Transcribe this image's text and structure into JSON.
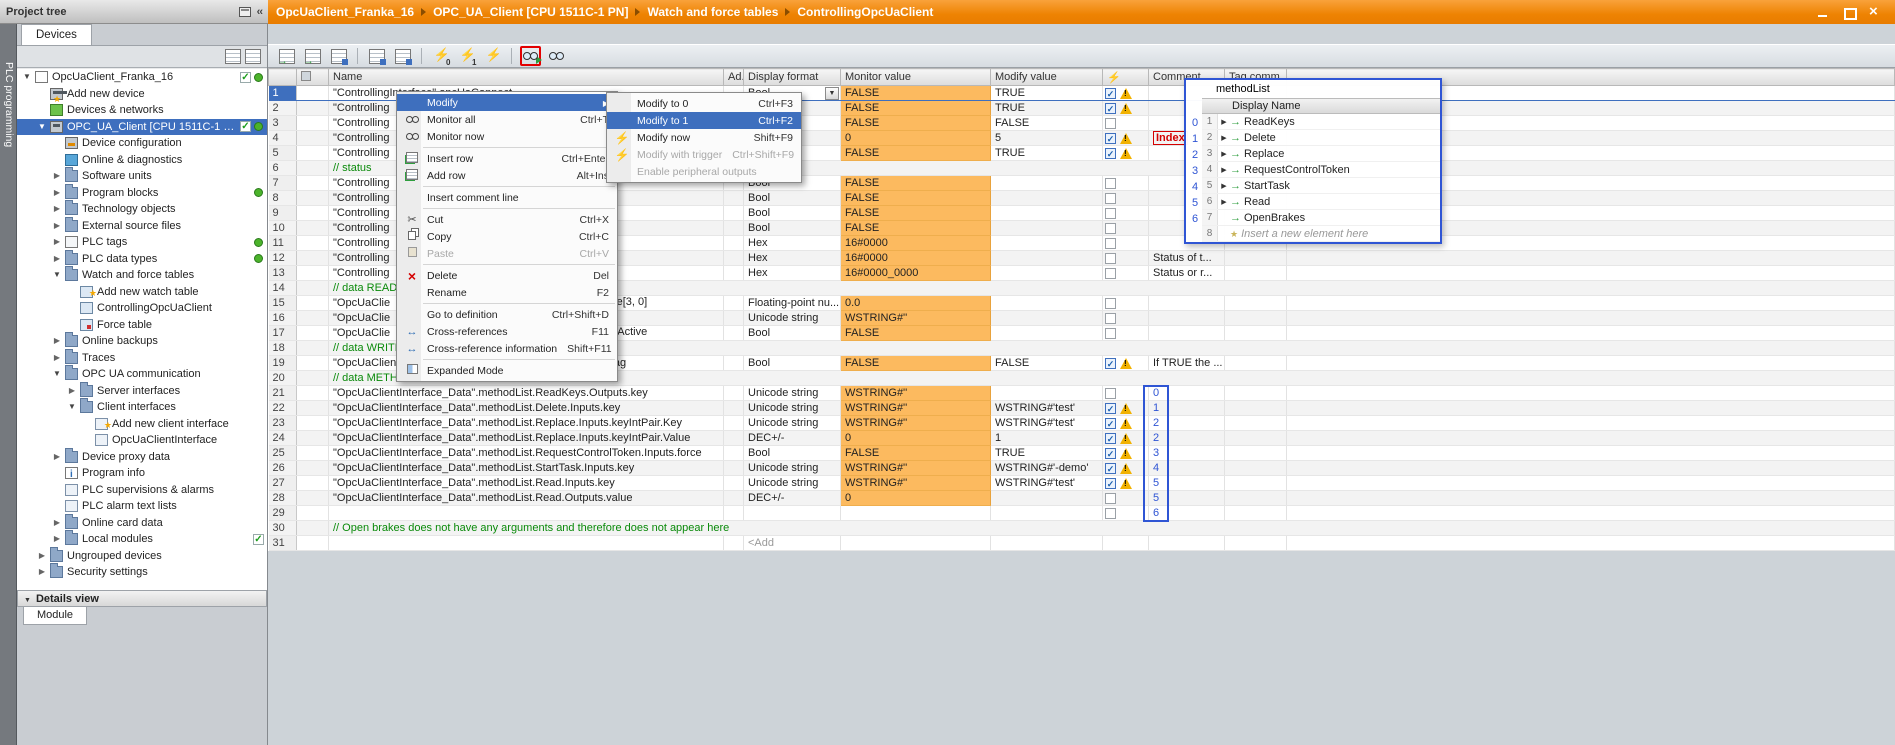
{
  "titlebar": {
    "project_tree": "Project tree",
    "breadcrumb": [
      "OpcUaClient_Franka_16",
      "OPC_UA_Client [CPU 1511C-1 PN]",
      "Watch and force tables",
      "ControllingOpcUaClient"
    ]
  },
  "sidebar": {
    "vertical_tab": "PLC programming",
    "devices_tab": "Devices",
    "details_view_label": "Details view",
    "module_tab_label": "Module",
    "tree": [
      {
        "label": "OpcUaClient_Franka_16",
        "level": 0,
        "arrow": "exp",
        "icon": "i-project",
        "status": [
          "check",
          "dot"
        ]
      },
      {
        "label": "Add new device",
        "level": 1,
        "icon": "i-plc",
        "star": true
      },
      {
        "label": "Devices & networks",
        "level": 1,
        "icon": "i-network"
      },
      {
        "label": "OPC_UA_Client [CPU 1511C-1 PN]",
        "level": 1,
        "arrow": "exp",
        "icon": "i-plc",
        "status": [
          "check",
          "dot"
        ],
        "selected": true
      },
      {
        "label": "Device configuration",
        "level": 2,
        "icon": "i-devconf"
      },
      {
        "label": "Online & diagnostics",
        "level": 2,
        "icon": "i-diag"
      },
      {
        "label": "Software units",
        "level": 2,
        "arrow": "col",
        "icon": "i-folder"
      },
      {
        "label": "Program blocks",
        "level": 2,
        "arrow": "col",
        "icon": "i-folder",
        "status": [
          "dot"
        ]
      },
      {
        "label": "Technology objects",
        "level": 2,
        "arrow": "col",
        "icon": "i-folder"
      },
      {
        "label": "External source files",
        "level": 2,
        "arrow": "col",
        "icon": "i-folder"
      },
      {
        "label": "PLC tags",
        "level": 2,
        "arrow": "col",
        "icon": "i-tags",
        "status": [
          "dot"
        ]
      },
      {
        "label": "PLC data types",
        "level": 2,
        "arrow": "col",
        "icon": "i-folder",
        "status": [
          "dot"
        ]
      },
      {
        "label": "Watch and force tables",
        "level": 2,
        "arrow": "exp",
        "icon": "i-folder"
      },
      {
        "label": "Add new watch table",
        "level": 3,
        "icon": "i-watch",
        "star": true
      },
      {
        "label": "ControllingOpcUaClient",
        "level": 3,
        "icon": "i-watch"
      },
      {
        "label": "Force table",
        "level": 3,
        "icon": "i-force"
      },
      {
        "label": "Online backups",
        "level": 2,
        "arrow": "col",
        "icon": "i-folder"
      },
      {
        "label": "Traces",
        "level": 2,
        "arrow": "col",
        "icon": "i-folder"
      },
      {
        "label": "OPC UA communication",
        "level": 2,
        "arrow": "exp",
        "icon": "i-folder"
      },
      {
        "label": "Server interfaces",
        "level": 3,
        "arrow": "col",
        "icon": "i-folder"
      },
      {
        "label": "Client interfaces",
        "level": 3,
        "arrow": "exp",
        "icon": "i-folder"
      },
      {
        "label": "Add new client interface",
        "level": 4,
        "icon": "i-iface",
        "star": true
      },
      {
        "label": "OpcUaClientInterface",
        "level": 4,
        "icon": "i-iface"
      },
      {
        "label": "Device proxy data",
        "level": 2,
        "arrow": "col",
        "icon": "i-folder"
      },
      {
        "label": "Program info",
        "level": 2,
        "icon": "i-info"
      },
      {
        "label": "PLC supervisions & alarms",
        "level": 2,
        "icon": "i-superv"
      },
      {
        "label": "PLC alarm text lists",
        "level": 2,
        "icon": "i-alarm"
      },
      {
        "label": "Online card data",
        "level": 2,
        "arrow": "col",
        "icon": "i-folder"
      },
      {
        "label": "Local modules",
        "level": 2,
        "arrow": "col",
        "icon": "i-folder",
        "status": [
          "check"
        ]
      },
      {
        "label": "Ungrouped devices",
        "level": 1,
        "arrow": "col",
        "icon": "i-folder"
      },
      {
        "label": "Security settings",
        "level": 1,
        "arrow": "col",
        "icon": "i-folder"
      }
    ]
  },
  "toolbar": {
    "icons": [
      {
        "name": "insert-row-icon",
        "cls": "grid g-green"
      },
      {
        "name": "add-row-icon",
        "cls": "grid g-green"
      },
      {
        "name": "insert-comment-icon",
        "cls": "grid g-blue"
      },
      {
        "sep": true
      },
      {
        "name": "show-all-format-icon",
        "cls": "grid g-blue"
      },
      {
        "name": "show-modify-column-icon",
        "cls": "grid g-blue"
      },
      {
        "sep": true
      },
      {
        "name": "modify-to-0-icon",
        "cls": "bolt",
        "sub": "0"
      },
      {
        "name": "modify-to-1-icon",
        "cls": "bolt",
        "sub": "1"
      },
      {
        "name": "modify-now-icon",
        "cls": "bolt"
      },
      {
        "sep": true
      },
      {
        "name": "monitor-all-icon",
        "cls": "glasses play",
        "redbox": true
      },
      {
        "name": "monitor-now-icon",
        "cls": "glasses"
      }
    ]
  },
  "table": {
    "headers": [
      "",
      "",
      "Name",
      "Ad...",
      "Display format",
      "Monitor value",
      "Modify value",
      "",
      "Comment",
      "Tag comm...",
      ""
    ],
    "rows": [
      {
        "n": 1,
        "name": "\"ControllingInterface\".opcUaConnect",
        "display": "Bool",
        "monitor": "FALSE",
        "morange": true,
        "modify": "TRUE",
        "check": "on",
        "warn": true,
        "sel": true,
        "combo": true
      },
      {
        "n": 2,
        "name": "\"Controlling",
        "display": "Bool",
        "monitor": "FALSE",
        "morange": true,
        "modify": "TRUE",
        "check": "on",
        "warn": true
      },
      {
        "n": 3,
        "name": "\"Controlling",
        "display": "Bool",
        "monitor": "FALSE",
        "morange": true,
        "modify": "FALSE",
        "check": "off"
      },
      {
        "n": 4,
        "name": "\"Controlling",
        "display": "DEC+/-",
        "monitor": "0",
        "morange": true,
        "modify": "5",
        "check": "on",
        "warn": true,
        "comment": "Index",
        "commentRed": true
      },
      {
        "n": 5,
        "name": "\"Controlling",
        "display": "Bool",
        "monitor": "FALSE",
        "morange": true,
        "modify": "TRUE",
        "check": "on",
        "warn": true
      },
      {
        "n": 6,
        "kind": "comment",
        "name": "// status"
      },
      {
        "n": 7,
        "name": "\"Controlling",
        "display": "Bool",
        "monitor": "FALSE",
        "morange": true,
        "check": "off"
      },
      {
        "n": 8,
        "name": "\"Controlling",
        "display": "Bool",
        "monitor": "FALSE",
        "morange": true,
        "check": "off"
      },
      {
        "n": 9,
        "name": "\"Controlling",
        "display": "Bool",
        "monitor": "FALSE",
        "morange": true,
        "check": "off"
      },
      {
        "n": 10,
        "name": "\"Controlling",
        "display": "Bool",
        "monitor": "FALSE",
        "morange": true,
        "check": "off"
      },
      {
        "n": 11,
        "name": "\"Controlling",
        "display": "Hex",
        "monitor": "16#0000",
        "morange": true,
        "check": "off"
      },
      {
        "n": 12,
        "name": "\"Controlling",
        "display": "Hex",
        "monitor": "16#0000",
        "morange": true,
        "check": "off",
        "comment": "Status of t..."
      },
      {
        "n": 13,
        "name": "\"Controlling",
        "tail": "s",
        "display": "Hex",
        "monitor": "16#0000_0000",
        "morange": true,
        "check": "off",
        "comment": "Status or r..."
      },
      {
        "n": 14,
        "kind": "comment",
        "name": "// data READ"
      },
      {
        "n": 15,
        "name": "\"OpcUaClie",
        "tail": "ose[3, 0]",
        "display": "Floating-point nu...",
        "monitor": "0.0",
        "morange": true,
        "check": "off"
      },
      {
        "n": 16,
        "name": "\"OpcUaClie",
        "display": "Unicode string",
        "monitor": "WSTRING#''",
        "morange": true,
        "check": "off"
      },
      {
        "n": 17,
        "name": "\"OpcUaClie",
        "tail": "enActive",
        "display": "Bool",
        "monitor": "FALSE",
        "morange": true,
        "check": "off"
      },
      {
        "n": 18,
        "kind": "comment",
        "name": "// data WRITE"
      },
      {
        "n": 19,
        "name": "\"OpcUaClientInterface_Data\".writeList.Variable.EnabledFlag",
        "display": "Bool",
        "monitor": "FALSE",
        "morange": true,
        "modify": "FALSE",
        "check": "on",
        "warn": true,
        "comment": "If TRUE the ..."
      },
      {
        "n": 20,
        "kind": "comment",
        "name": "// data METHOD"
      },
      {
        "n": 21,
        "name": "\"OpcUaClientInterface_Data\".methodList.ReadKeys.Outputs.key",
        "display": "Unicode string",
        "monitor": "WSTRING#''",
        "morange": true,
        "check": "off",
        "idx": "0"
      },
      {
        "n": 22,
        "name": "\"OpcUaClientInterface_Data\".methodList.Delete.Inputs.key",
        "display": "Unicode string",
        "monitor": "WSTRING#''",
        "morange": true,
        "modify": "WSTRING#'test'",
        "check": "on",
        "warn": true,
        "idx": "1"
      },
      {
        "n": 23,
        "name": "\"OpcUaClientInterface_Data\".methodList.Replace.Inputs.keyIntPair.Key",
        "display": "Unicode string",
        "monitor": "WSTRING#''",
        "morange": true,
        "modify": "WSTRING#'test'",
        "check": "on",
        "warn": true,
        "idx": "2"
      },
      {
        "n": 24,
        "name": "\"OpcUaClientInterface_Data\".methodList.Replace.Inputs.keyIntPair.Value",
        "display": "DEC+/-",
        "monitor": "0",
        "morange": true,
        "modify": "1",
        "check": "on",
        "warn": true,
        "idx": "2"
      },
      {
        "n": 25,
        "name": "\"OpcUaClientInterface_Data\".methodList.RequestControlToken.Inputs.force",
        "display": "Bool",
        "monitor": "FALSE",
        "morange": true,
        "modify": "TRUE",
        "check": "on",
        "warn": true,
        "idx": "3"
      },
      {
        "n": 26,
        "name": "\"OpcUaClientInterface_Data\".methodList.StartTask.Inputs.key",
        "display": "Unicode string",
        "monitor": "WSTRING#''",
        "morange": true,
        "modify": "WSTRING#'-demo'",
        "check": "on",
        "warn": true,
        "idx": "4"
      },
      {
        "n": 27,
        "name": "\"OpcUaClientInterface_Data\".methodList.Read.Inputs.key",
        "display": "Unicode string",
        "monitor": "WSTRING#''",
        "morange": true,
        "modify": "WSTRING#'test'",
        "check": "on",
        "warn": true,
        "idx": "5"
      },
      {
        "n": 28,
        "name": "\"OpcUaClientInterface_Data\".methodList.Read.Outputs.value",
        "display": "DEC+/-",
        "monitor": "0",
        "morange": true,
        "check": "off",
        "idx": "5"
      },
      {
        "n": 29,
        "check": "off",
        "idx": "6"
      },
      {
        "n": 30,
        "kind": "comment",
        "name": "// Open brakes does not have any arguments and therefore does not appear here"
      },
      {
        "n": 31,
        "display": "<Add",
        "displayGrey": true
      }
    ]
  },
  "context_menu": {
    "items": [
      {
        "label": "Modify",
        "icon": "",
        "submenu": true,
        "highlighted": true
      },
      {
        "label": "Monitor all",
        "shortcut": "Ctrl+T",
        "icon": "glasses"
      },
      {
        "label": "Monitor now",
        "icon": "glasses"
      },
      {
        "separator": true
      },
      {
        "label": "Insert row",
        "shortcut": "Ctrl+Enter",
        "icon": "grid-green"
      },
      {
        "label": "Add row",
        "shortcut": "Alt+Ins",
        "icon": "grid-green"
      },
      {
        "separator": true
      },
      {
        "label": "Insert comment line",
        "icon": ""
      },
      {
        "separator": true
      },
      {
        "label": "Cut",
        "shortcut": "Ctrl+X",
        "icon": "cut"
      },
      {
        "label": "Copy",
        "shortcut": "Ctrl+C",
        "icon": "copy"
      },
      {
        "label": "Paste",
        "shortcut": "Ctrl+V",
        "icon": "paste",
        "disabled": true
      },
      {
        "separator": true
      },
      {
        "label": "Delete",
        "shortcut": "Del",
        "icon": "delete"
      },
      {
        "label": "Rename",
        "shortcut": "F2",
        "icon": ""
      },
      {
        "separator": true
      },
      {
        "label": "Go to definition",
        "shortcut": "Ctrl+Shift+D",
        "icon": ""
      },
      {
        "label": "Cross-references",
        "shortcut": "F11",
        "icon": "xref"
      },
      {
        "label": "Cross-reference information",
        "shortcut": "Shift+F11",
        "icon": "xref"
      },
      {
        "separator": true
      },
      {
        "label": "Expanded Mode",
        "icon": "expand"
      }
    ]
  },
  "context_submenu": {
    "items": [
      {
        "label": "Modify to 0",
        "shortcut": "Ctrl+F3",
        "icon": ""
      },
      {
        "label": "Modify to 1",
        "shortcut": "Ctrl+F2",
        "icon": "",
        "highlighted": true
      },
      {
        "label": "Modify now",
        "shortcut": "Shift+F9",
        "icon": "bolt"
      },
      {
        "label": "Modify with trigger",
        "shortcut": "Ctrl+Shift+F9",
        "icon": "bolt",
        "disabled": true
      },
      {
        "label": "Enable peripheral outputs",
        "icon": "",
        "disabled": true
      }
    ]
  },
  "method_list": {
    "title": "methodList",
    "header": "Display Name",
    "indices": [
      "0",
      "1",
      "2",
      "3",
      "4",
      "5",
      "6"
    ],
    "rows": [
      {
        "num": "1",
        "name": "ReadKeys",
        "expand": true
      },
      {
        "num": "2",
        "name": "Delete",
        "expand": true
      },
      {
        "num": "3",
        "name": "Replace",
        "expand": true
      },
      {
        "num": "4",
        "name": "RequestControlToken",
        "expand": true
      },
      {
        "num": "5",
        "name": "StartTask",
        "expand": true
      },
      {
        "num": "6",
        "name": "Read",
        "expand": true
      },
      {
        "num": "7",
        "name": "OpenBrakes",
        "expand": false
      },
      {
        "num": "8",
        "name": "Insert a new element here",
        "placeholder": true
      }
    ]
  },
  "colors": {
    "accent_orange": "#EE8302",
    "selection_blue": "#3E6FBE",
    "monitor_orange": "#FCBA5F",
    "comment_green": "#0A8A0A",
    "warning_yellow": "#F2B200",
    "overlay_blue": "#2F55D4",
    "annotation_red": "#E30000"
  }
}
